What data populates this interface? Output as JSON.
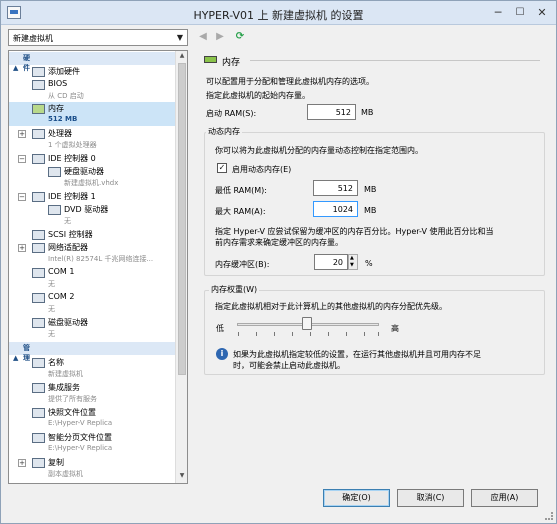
{
  "window": {
    "title": "HYPER-V01 上 新建虚拟机 的设置",
    "buttons": {
      "minimize": "─",
      "maximize": "☐",
      "close": "✕"
    }
  },
  "combo": {
    "value": "新建虚拟机",
    "arrow": "▼"
  },
  "toolbar": {
    "back": "◀",
    "forward": "▶",
    "refresh": "⟳"
  },
  "sidebar": {
    "hardware_heading": "硬件",
    "management_heading": "管理",
    "items": [
      {
        "name": "添加硬件",
        "sub": "",
        "icon": "add-hardware-icon",
        "expand": ""
      },
      {
        "name": "BIOS",
        "sub": "从 CD 启动",
        "icon": "bios-icon",
        "expand": ""
      },
      {
        "name": "内存",
        "sub": "512 MB",
        "icon": "memory-icon",
        "expand": ""
      },
      {
        "name": "处理器",
        "sub": "1 个虚拟处理器",
        "icon": "processor-icon",
        "expand": "+"
      },
      {
        "name": "IDE 控制器 0",
        "sub": "",
        "icon": "ide-controller-icon",
        "expand": "−"
      },
      {
        "name": "硬盘驱动器",
        "sub": "新建虚拟机.vhdx",
        "icon": "hard-drive-icon",
        "expand": ""
      },
      {
        "name": "IDE 控制器 1",
        "sub": "",
        "icon": "ide-controller-icon",
        "expand": "−"
      },
      {
        "name": "DVD 驱动器",
        "sub": "无",
        "icon": "dvd-drive-icon",
        "expand": ""
      },
      {
        "name": "SCSI 控制器",
        "sub": "",
        "icon": "scsi-controller-icon",
        "expand": ""
      },
      {
        "name": "网络适配器",
        "sub": "Intel(R) 82574L 千兆网络连接...",
        "icon": "network-adapter-icon",
        "expand": "+"
      },
      {
        "name": "COM 1",
        "sub": "无",
        "icon": "com-port-icon",
        "expand": ""
      },
      {
        "name": "COM 2",
        "sub": "无",
        "icon": "com-port-icon",
        "expand": ""
      },
      {
        "name": "磁盘驱动器",
        "sub": "无",
        "icon": "floppy-drive-icon",
        "expand": ""
      },
      {
        "name": "名称",
        "sub": "新建虚拟机",
        "icon": "name-icon",
        "expand": ""
      },
      {
        "name": "集成服务",
        "sub": "提供了所有服务",
        "icon": "integration-services-icon",
        "expand": ""
      },
      {
        "name": "快照文件位置",
        "sub": "E:\\Hyper-V Replica",
        "icon": "snapshot-location-icon",
        "expand": ""
      },
      {
        "name": "智能分页文件位置",
        "sub": "E:\\Hyper-V Replica",
        "icon": "paging-location-icon",
        "expand": ""
      },
      {
        "name": "复制",
        "sub": "副本虚拟机",
        "icon": "replication-icon",
        "expand": "+"
      }
    ]
  },
  "panel": {
    "header": "内存",
    "desc1": "可以配置用于分配和管理此虚拟机内存的选项。",
    "desc2": "指定此虚拟机的起始内存量。",
    "startup_ram_label": "启动 RAM(S):",
    "startup_ram_value": "512",
    "unit_mb": "MB",
    "dynamic": {
      "title": "动态内存",
      "desc": "你可以将为此虚拟机分配的内存量动态控制在指定范围内。",
      "enable_label": "启用动态内存(E)",
      "enabled": "✓",
      "min_label": "最低 RAM(M):",
      "min_value": "512",
      "max_label": "最大 RAM(A):",
      "max_value": "1024",
      "buffer_desc1": "指定 Hyper-V 应尝试保留为缓冲区的内存百分比。Hyper-V 使用此百分比和当",
      "buffer_desc2": "前内存需求来确定缓冲区的内存量。",
      "buffer_label": "内存缓冲区(B):",
      "buffer_value": "20",
      "percent": "%"
    },
    "weight": {
      "title": "内存权重(W)",
      "desc": "指定此虚拟机相对于此计算机上的其他虚拟机的内存分配优先级。",
      "low": "低",
      "high": "高",
      "level": 0.5,
      "info_icon": "i",
      "info1": "如果为此虚拟机指定较低的设置，在运行其他虚拟机并且可用内存不足",
      "info2": "时，可能会禁止启动此虚拟机。"
    }
  },
  "footer": {
    "ok": "确定(O)",
    "cancel": "取消(C)",
    "apply": "应用(A)"
  }
}
